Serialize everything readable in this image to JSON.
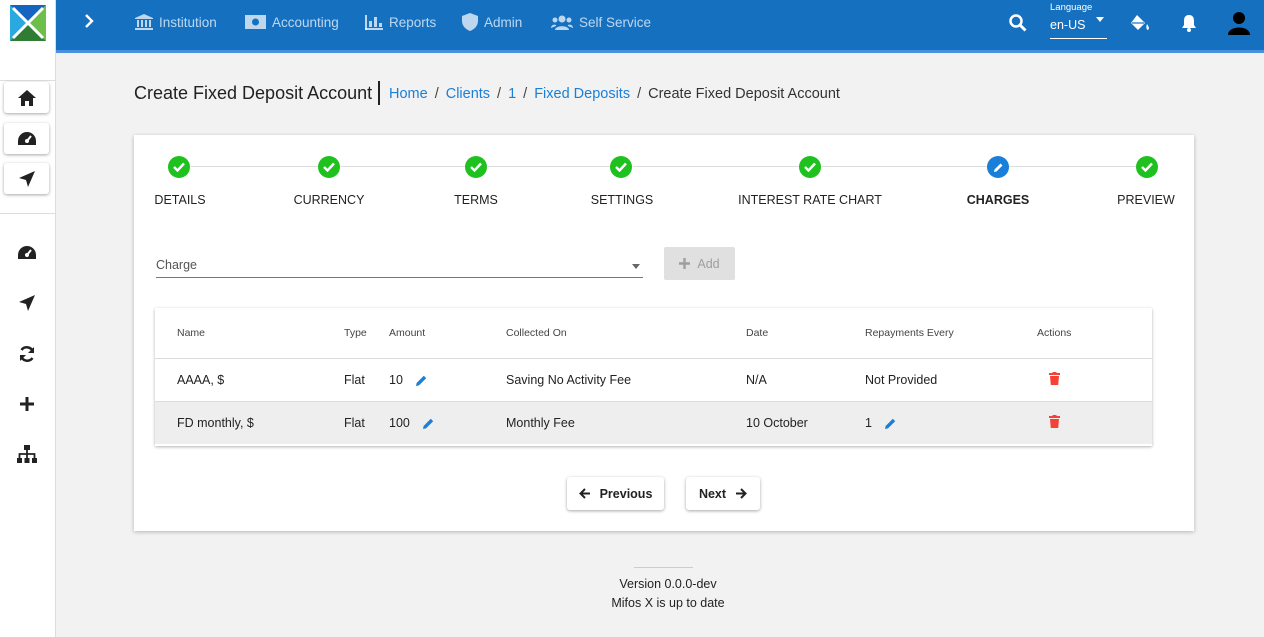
{
  "nav": {
    "items": [
      {
        "label": "Institution",
        "icon": "institution-icon"
      },
      {
        "label": "Accounting",
        "icon": "money-icon"
      },
      {
        "label": "Reports",
        "icon": "chart-bar-icon"
      },
      {
        "label": "Admin",
        "icon": "shield-icon"
      },
      {
        "label": "Self Service",
        "icon": "users-icon"
      }
    ],
    "language_label": "Language",
    "language_value": "en-US"
  },
  "page": {
    "title": "Create Fixed Deposit Account",
    "breadcrumb": [
      "Home",
      "Clients",
      "1",
      "Fixed Deposits"
    ],
    "breadcrumb_current": "Create Fixed Deposit Account"
  },
  "stepper": {
    "steps": [
      {
        "label": "DETAILS",
        "status": "done"
      },
      {
        "label": "CURRENCY",
        "status": "done"
      },
      {
        "label": "TERMS",
        "status": "done"
      },
      {
        "label": "SETTINGS",
        "status": "done"
      },
      {
        "label": "INTEREST RATE CHART",
        "status": "done"
      },
      {
        "label": "CHARGES",
        "status": "active"
      },
      {
        "label": "PREVIEW",
        "status": "done"
      }
    ]
  },
  "charge_form": {
    "placeholder": "Charge",
    "add_label": "Add"
  },
  "charges_table": {
    "headers": [
      "Name",
      "Type",
      "Amount",
      "Collected On",
      "Date",
      "Repayments Every",
      "Actions"
    ],
    "rows": [
      {
        "name": "AAAA, $",
        "type": "Flat",
        "amount": "10",
        "collected_on": "Saving No Activity Fee",
        "date": "N/A",
        "repayments_every": "Not Provided"
      },
      {
        "name": "FD monthly, $",
        "type": "Flat",
        "amount": "100",
        "collected_on": "Monthly Fee",
        "date": "10 October",
        "repayments_every": "1"
      }
    ]
  },
  "buttons": {
    "previous": "Previous",
    "next": "Next"
  },
  "footer": {
    "version": "Version 0.0.0-dev",
    "status": "Mifos X is up to date"
  },
  "colors": {
    "primary": "#1570c0",
    "step_done": "#1fc11f",
    "step_active": "#1a7fd8",
    "link": "#1a7fd8",
    "delete": "#f44336"
  }
}
